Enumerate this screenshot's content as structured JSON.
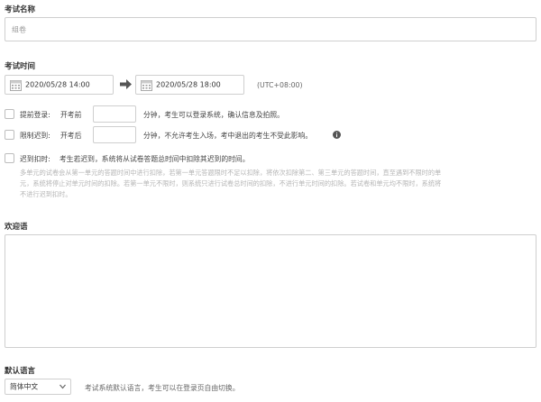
{
  "exam_name": {
    "label": "考试名称",
    "placeholder": "组卷"
  },
  "exam_time": {
    "label": "考试时间",
    "start": "2020/05/28 14:00",
    "end": "2020/05/28 18:00",
    "timezone": "(UTC+08:00)"
  },
  "early_login": {
    "label": "提前登录:",
    "prefix": "开考前",
    "suffix": "分钟，考生可以登录系统，确认信息及拍照。",
    "checked": false
  },
  "late_limit": {
    "label": "限制迟到:",
    "prefix": "开考后",
    "suffix": "分钟，不允许考生入场，考中退出的考生不受此影响。",
    "checked": false
  },
  "late_deduct": {
    "label": "迟到扣时:",
    "text": "考生若迟到，系统将从试卷答题总时间中扣除其迟到的时间。",
    "checked": false,
    "note_lines": [
      "多单元的试卷会从第一单元的答题时间中进行扣除，若第一单元答题限时不足以扣除，将依次扣除第二、第三单元的答题时间，直至遇到不限时的单",
      "元，系统将停止对单元时间的扣除。若第一单元不限时，则系统只进行试卷总时间的扣除，不进行单元时间的扣除。若试卷和单元均不限时，系统将",
      "不进行迟到扣时。"
    ]
  },
  "welcome": {
    "label": "欢迎语"
  },
  "default_language": {
    "label": "默认语言",
    "selected": "简体中文",
    "hint": "考试系统默认语言，考生可以在登录页自由切换。"
  },
  "colors": {
    "border": "#cfcfcf",
    "text": "#333333",
    "muted": "#b5b5b5",
    "icon": "#555555"
  }
}
